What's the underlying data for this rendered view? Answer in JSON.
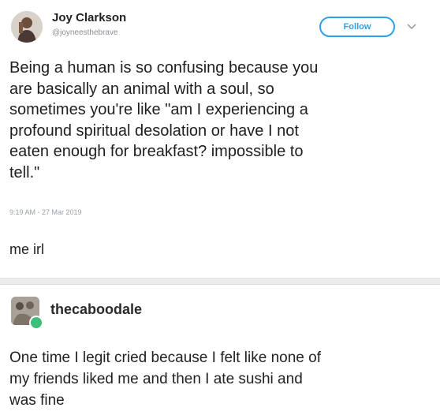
{
  "tweet": {
    "author_name": "Joy Clarkson",
    "handle": "@joyneesthebrave",
    "follow_label": "Follow",
    "text": "Being a human is so confusing because you\nare basically an animal with a soul, so\nsometimes you're like \"am I experiencing a\nprofound spiritual desolation or have I not\neaten enough for breakfast? impossible to\ntell.\"",
    "timestamp": "9:19 AM - 27 Mar 2019"
  },
  "caption": "me irl",
  "reblog": {
    "username": "thecaboodale",
    "text": "One time I legit cried because I felt like none of\nmy friends liked me and then I ate sushi and\nwas fine"
  },
  "colors": {
    "accent": "#2ea0ea",
    "badge": "#3cbf7a",
    "divider": "#ececec"
  },
  "icons": [
    "avatar-photo",
    "chevron-down-icon",
    "reblog-avatar-photo",
    "online-badge-icon"
  ]
}
